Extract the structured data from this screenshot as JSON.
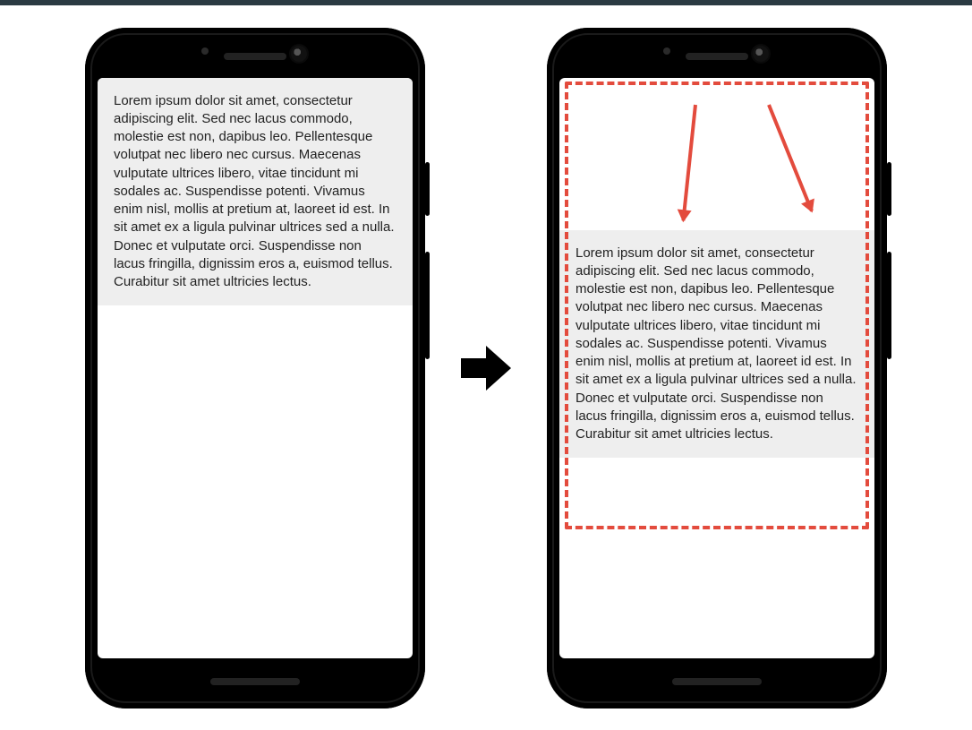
{
  "lorem_text": "Lorem ipsum dolor sit amet, consectetur adipiscing elit. Sed nec lacus commodo, molestie est non, dapibus leo. Pellentesque volutpat nec libero nec cursus. Maecenas vulputate ultrices libero, vitae tincidunt mi sodales ac. Suspendisse potenti. Vivamus enim nisl, mollis at pretium at, laoreet id est. In sit amet ex a ligula pulvinar ultrices sed a nulla. Donec et vulputate orci. Suspendisse non lacus fringilla, dignissim eros a, euismod tellus. Curabitur sit amet ultricies lectus.",
  "colors": {
    "highlight_red": "#e34b3d",
    "card_bg": "#eeeeee"
  }
}
